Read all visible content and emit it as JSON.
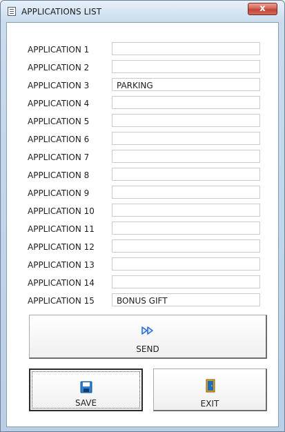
{
  "window": {
    "title": "APPLICATIONS LIST",
    "close_glyph": "x"
  },
  "applications": [
    {
      "label": "APPLICATION 1",
      "value": ""
    },
    {
      "label": "APPLICATION 2",
      "value": ""
    },
    {
      "label": "APPLICATION 3",
      "value": "PARKING"
    },
    {
      "label": "APPLICATION 4",
      "value": ""
    },
    {
      "label": "APPLICATION 5",
      "value": ""
    },
    {
      "label": "APPLICATION 6",
      "value": ""
    },
    {
      "label": "APPLICATION 7",
      "value": ""
    },
    {
      "label": "APPLICATION 8",
      "value": ""
    },
    {
      "label": "APPLICATION 9",
      "value": ""
    },
    {
      "label": "APPLICATION 10",
      "value": ""
    },
    {
      "label": "APPLICATION 11",
      "value": ""
    },
    {
      "label": "APPLICATION 12",
      "value": ""
    },
    {
      "label": "APPLICATION 13",
      "value": ""
    },
    {
      "label": "APPLICATION 14",
      "value": ""
    },
    {
      "label": "APPLICATION 15",
      "value": "BONUS GIFT"
    }
  ],
  "buttons": {
    "send_label": "SEND",
    "save_label": "SAVE",
    "exit_label": "EXIT"
  },
  "icons": {
    "title": "list-icon",
    "send": "fast-forward-icon",
    "save": "floppy-disk-icon",
    "exit": "door-icon"
  },
  "colors": {
    "send_icon": "#2f6fd8",
    "save_icon": "#2f7fd0",
    "exit_icon": "#e0a020",
    "close_button": "#c9463a"
  }
}
